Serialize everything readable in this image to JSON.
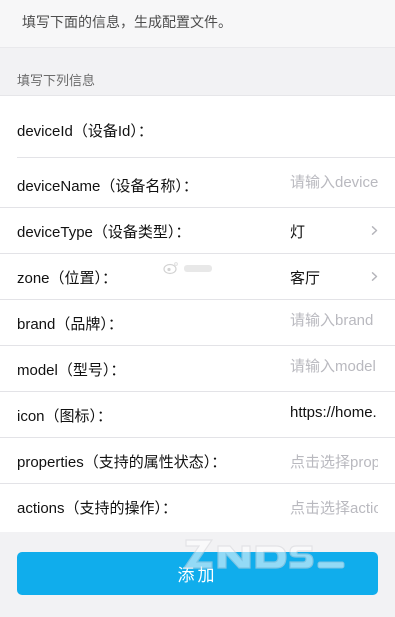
{
  "intro": {
    "text": "填写下面的信息，生成配置文件。"
  },
  "section": {
    "label": "填写下列信息"
  },
  "form": {
    "fields": [
      {
        "label": "deviceId（设备Id）：",
        "value": "",
        "placeholder": ""
      },
      {
        "label": "deviceName（设备名称）：",
        "value": "",
        "placeholder": "请输入deviceName"
      },
      {
        "label": "deviceType（设备类型）：",
        "value": "灯"
      },
      {
        "label": "zone（位置）：",
        "value": "客厅"
      },
      {
        "label": "brand（品牌）：",
        "value": "",
        "placeholder": "请输入brand"
      },
      {
        "label": "model（型号）：",
        "value": "",
        "placeholder": "请输入model"
      },
      {
        "label": "icon（图标）：",
        "value": "https://home.",
        "placeholder": ""
      },
      {
        "label": "properties（支持的属性状态）：",
        "value": "点击选择properties"
      },
      {
        "label": "actions（支持的操作）：",
        "value": "点击选择actions"
      }
    ]
  },
  "add_button": {
    "label": "添加"
  },
  "colors": {
    "accent": "#10adec",
    "placeholder": "#b9b9bf",
    "page_bg": "#f2f2f4",
    "separator": "#e3e3e7"
  },
  "icons": {
    "select_indicator": "chevron-right-icon"
  }
}
